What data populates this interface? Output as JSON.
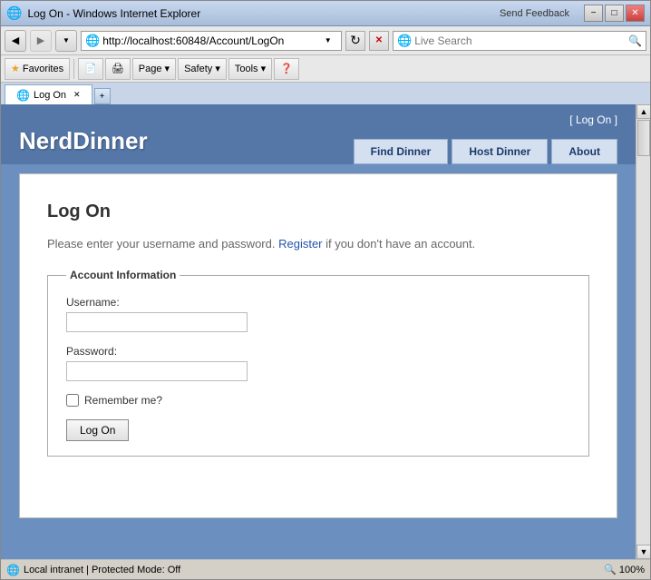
{
  "window": {
    "title": "Log On - Windows Internet Explorer",
    "send_feedback": "Send Feedback",
    "title_btn_min": "−",
    "title_btn_max": "□",
    "title_btn_close": "✕"
  },
  "address_bar": {
    "url": "http://localhost:60848/Account/LogOn",
    "live_search_placeholder": "Live Search"
  },
  "toolbar": {
    "favorites_label": "Favorites",
    "tab_label": "Log On",
    "page_btn": "Page ▾",
    "safety_btn": "Safety ▾",
    "tools_btn": "Tools ▾"
  },
  "site": {
    "logo": "NerdDinner",
    "log_on_link_prefix": "[ ",
    "log_on_link": "Log On",
    "log_on_link_suffix": " ]",
    "nav": {
      "find_dinner": "Find Dinner",
      "host_dinner": "Host Dinner",
      "about": "About"
    }
  },
  "logon_form": {
    "title": "Log On",
    "description_prefix": "Please enter your username and password. ",
    "register_link": "Register",
    "description_suffix": " if you don't have an account.",
    "fieldset_legend": "Account Information",
    "username_label": "Username:",
    "password_label": "Password:",
    "remember_label": "Remember me?",
    "submit_label": "Log On"
  },
  "status_bar": {
    "status_text": "Local intranet | Protected Mode: Off",
    "zoom": "🔍 100%"
  }
}
